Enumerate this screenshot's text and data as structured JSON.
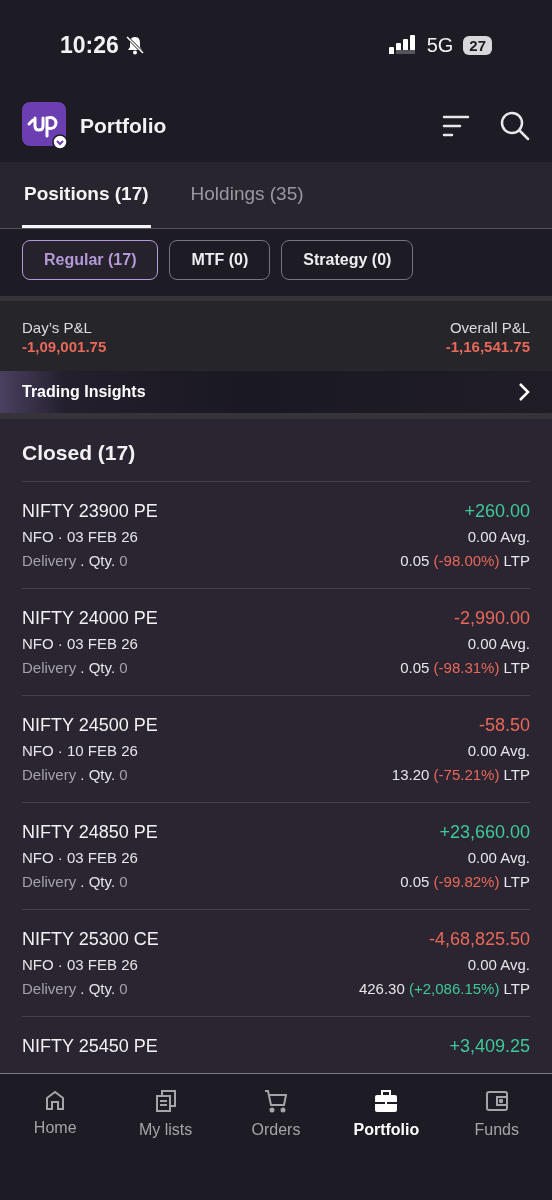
{
  "status_bar": {
    "time": "10:26",
    "network": "5G",
    "battery": "27"
  },
  "header": {
    "title": "Portfolio"
  },
  "tabs": [
    {
      "label": "Positions (17)",
      "selected": true
    },
    {
      "label": "Holdings (35)",
      "selected": false
    }
  ],
  "filters": [
    {
      "label": "Regular (17)",
      "selected": true
    },
    {
      "label": "MTF (0)",
      "selected": false
    },
    {
      "label": "Strategy (0)",
      "selected": false
    }
  ],
  "summary": [
    {
      "label": "Day’s P&L",
      "value": "-1,09,001.75",
      "kind": "loss"
    },
    {
      "label": "Overall P&L",
      "value": "-1,16,541.75",
      "kind": "loss"
    }
  ],
  "insights": {
    "label": "Trading Insights"
  },
  "section": {
    "title": "Closed (17)"
  },
  "positions": [
    {
      "name": "NIFTY 23900 PE",
      "pnl": {
        "text": "+260.00",
        "kind": "gain"
      },
      "contract": "NFO · 03 FEB 26",
      "avg": "0.00 Avg.",
      "product": "Delivery",
      "qty_label": ". Qty.",
      "qty": "0",
      "ltp": "0.05",
      "change": {
        "text": "(-98.00%)",
        "kind": "loss"
      },
      "ltp_label": "LTP"
    },
    {
      "name": "NIFTY 24000 PE",
      "pnl": {
        "text": "-2,990.00",
        "kind": "loss"
      },
      "contract": "NFO · 03 FEB 26",
      "avg": "0.00 Avg.",
      "product": "Delivery",
      "qty_label": ". Qty.",
      "qty": "0",
      "ltp": "0.05",
      "change": {
        "text": "(-98.31%)",
        "kind": "loss"
      },
      "ltp_label": "LTP"
    },
    {
      "name": "NIFTY 24500 PE",
      "pnl": {
        "text": "-58.50",
        "kind": "loss"
      },
      "contract": "NFO · 10 FEB 26",
      "avg": "0.00 Avg.",
      "product": "Delivery",
      "qty_label": ". Qty.",
      "qty": "0",
      "ltp": "13.20",
      "change": {
        "text": "(-75.21%)",
        "kind": "loss"
      },
      "ltp_label": "LTP"
    },
    {
      "name": "NIFTY 24850 PE",
      "pnl": {
        "text": "+23,660.00",
        "kind": "gain"
      },
      "contract": "NFO · 03 FEB 26",
      "avg": "0.00 Avg.",
      "product": "Delivery",
      "qty_label": ". Qty.",
      "qty": "0",
      "ltp": "0.05",
      "change": {
        "text": "(-99.82%)",
        "kind": "loss"
      },
      "ltp_label": "LTP"
    },
    {
      "name": "NIFTY 25300 CE",
      "pnl": {
        "text": "-4,68,825.50",
        "kind": "loss"
      },
      "contract": "NFO · 03 FEB 26",
      "avg": "0.00 Avg.",
      "product": "Delivery",
      "qty_label": ". Qty.",
      "qty": "0",
      "ltp": "426.30",
      "change": {
        "text": "(+2,086.15%)",
        "kind": "gain"
      },
      "ltp_label": "LTP"
    },
    {
      "name": "NIFTY 25450 PE",
      "pnl": {
        "text": "+3,409.25",
        "kind": "gain"
      }
    }
  ],
  "bottom_nav": [
    {
      "label": "Home",
      "selected": false
    },
    {
      "label": "My lists",
      "selected": false
    },
    {
      "label": "Orders",
      "selected": false
    },
    {
      "label": "Portfolio",
      "selected": true
    },
    {
      "label": "Funds",
      "selected": false
    }
  ]
}
